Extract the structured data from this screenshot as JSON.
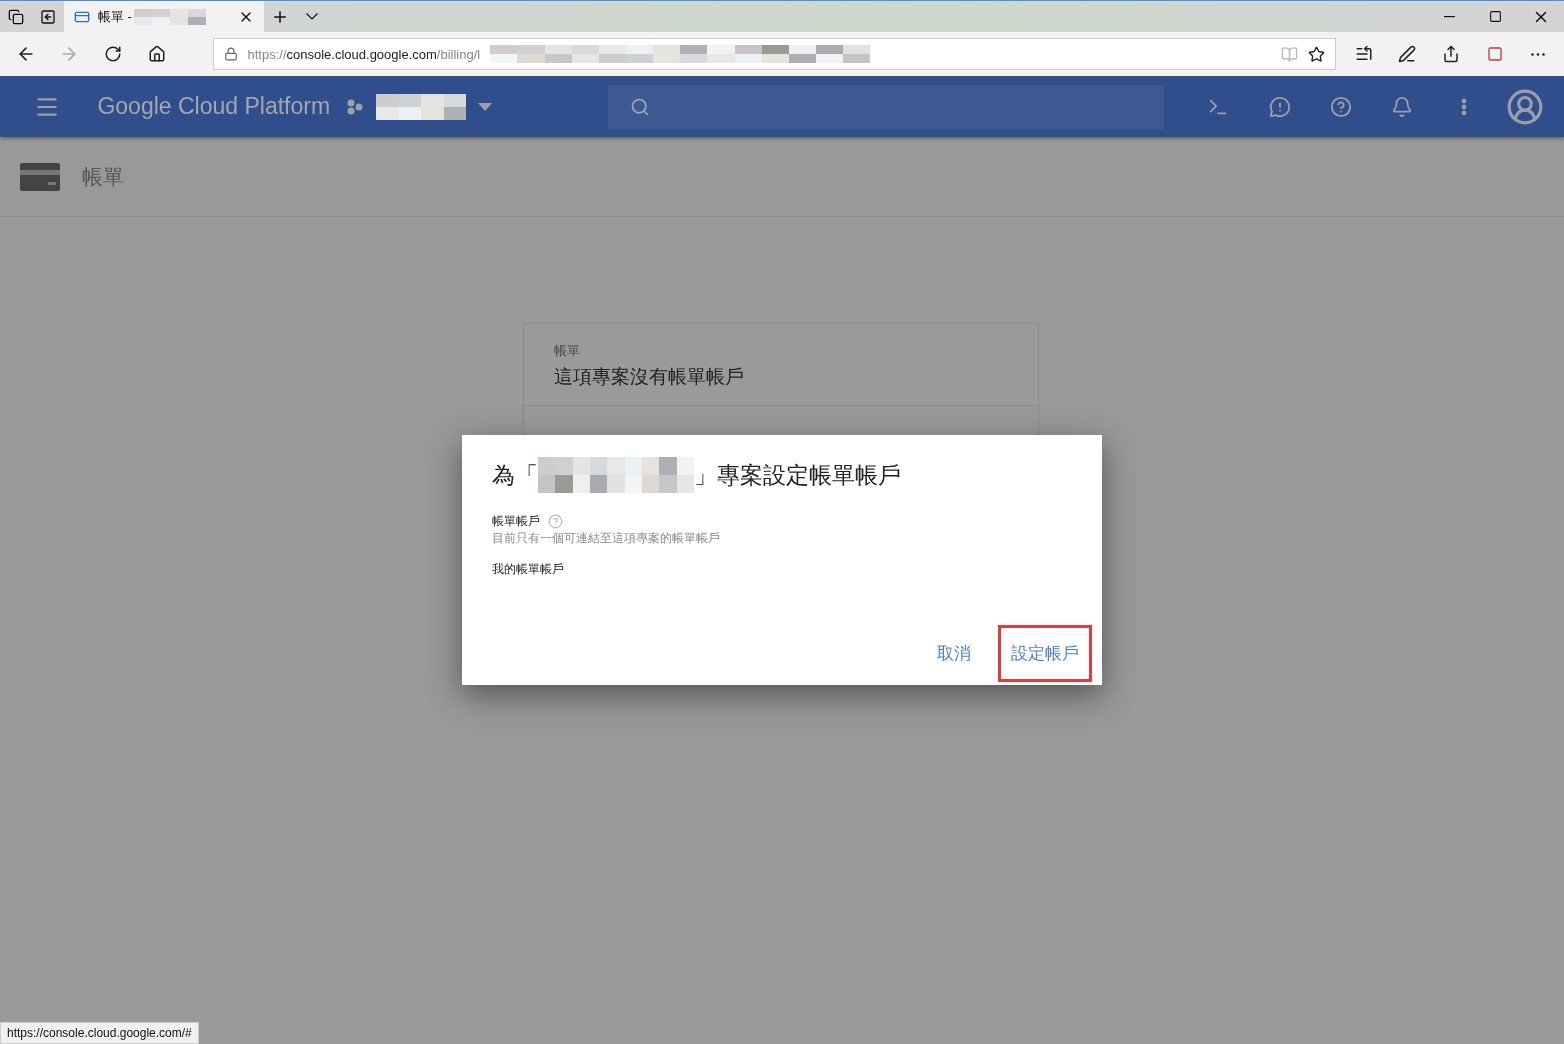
{
  "browser": {
    "tab": {
      "title": "帳單 -",
      "selected": true
    },
    "url": {
      "scheme": "https://",
      "host": "console.cloud.google.com",
      "path": "/billing/l"
    },
    "status_url": "https://console.cloud.google.com/#"
  },
  "topbar": {
    "logo": "Google Cloud Platform"
  },
  "page": {
    "title": "帳單"
  },
  "card": {
    "label": "帳單",
    "text": "這項專案沒有帳單帳戶"
  },
  "dialog": {
    "title_prefix": "為「",
    "title_suffix": "」專案設定帳單帳戶",
    "field_label": "帳單帳戶",
    "field_hint": "目前只有一個可連結至這項專案的帳單帳戶",
    "field_value": "我的帳單帳戶",
    "buttons": [
      {
        "label": "取消",
        "highlighted": false
      },
      {
        "label": "設定帳戶",
        "highlighted": true
      }
    ]
  }
}
